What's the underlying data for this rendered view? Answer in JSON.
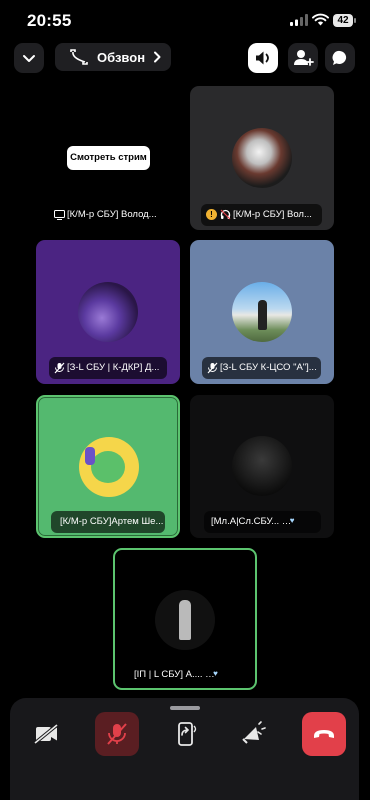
{
  "status_bar": {
    "time": "20:55",
    "battery": "42"
  },
  "header": {
    "call_name": "Обзвон"
  },
  "stream": {
    "button_label": "Смотреть стрим"
  },
  "tiles": [
    {
      "label": "[К/М-р СБУ] Волод..."
    },
    {
      "label": "[К/М-р СБУ] Вол..."
    },
    {
      "label": "[З-L СБУ | К-ДКР] Д..."
    },
    {
      "label": "[З-L СБУ К-ЦСО \"А\"]..."
    },
    {
      "label": "[К/М-р СБУ]Артем Ше..."
    },
    {
      "label": "[Мл.А|Сл.СБУ...",
      "badge": "UGTA"
    },
    {
      "label": "[IП | L СБУ] А....",
      "badge": "UGTA"
    }
  ],
  "colors": {
    "purple_tile": "#4b2482",
    "blue_tile": "#6b82a8",
    "green_tile": "#54b96f",
    "speaking_border": "#5cc46f",
    "end_call": "#e2404a"
  },
  "icons": [
    "signal-icon",
    "wifi-icon",
    "chevron-down-icon",
    "phone-icon",
    "chevron-right-icon",
    "speaker-icon",
    "add-user-icon",
    "chat-icon",
    "screen-icon",
    "warning-icon",
    "headphones-icon",
    "mic-muted-icon",
    "camera-off-icon",
    "screen-share-icon",
    "soundboard-icon",
    "end-call-icon"
  ]
}
